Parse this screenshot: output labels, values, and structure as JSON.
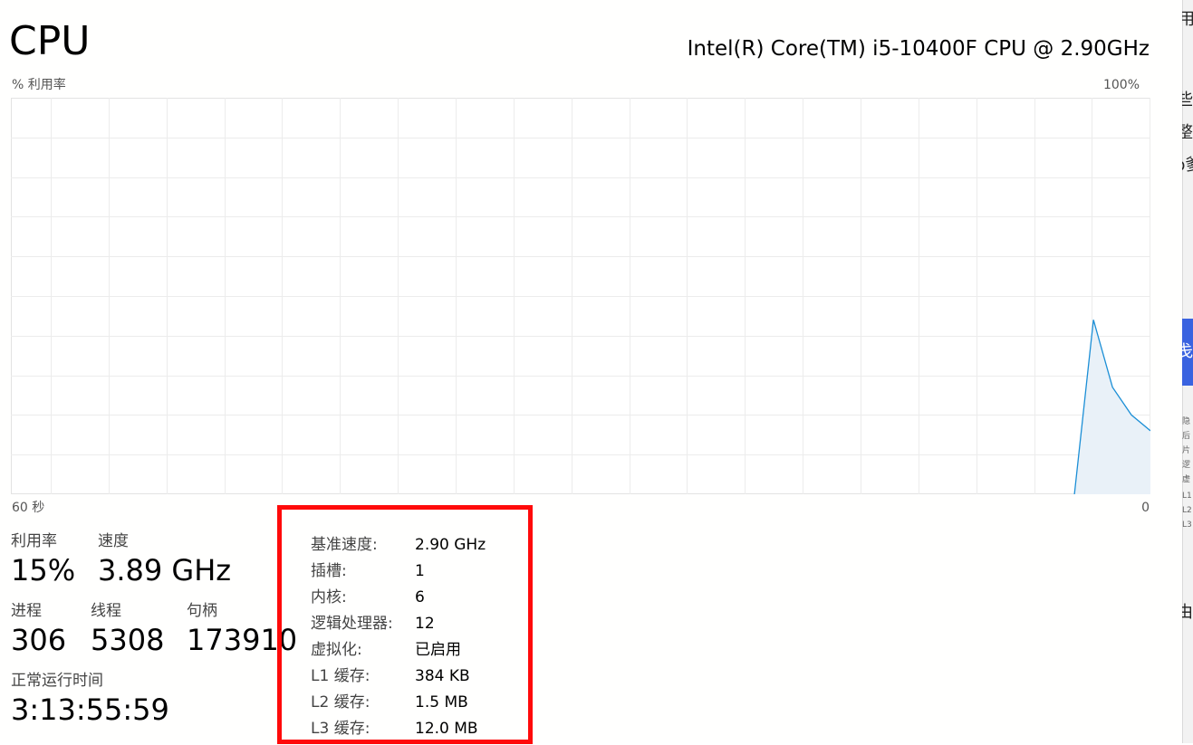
{
  "header": {
    "title": "CPU",
    "cpu_model": "Intel(R) Core(TM) i5-10400F CPU @ 2.90GHz"
  },
  "graph": {
    "y_label": "% 利用率",
    "y_max_label": "100%",
    "x_left_label": "60 秒",
    "x_right_label": "0",
    "utilization_percent_recent": [
      0,
      44,
      27,
      20,
      16
    ],
    "line_color": "#1c8fd6",
    "fill_color": "#e9f1f8",
    "grid_color": "#ececec"
  },
  "stats": {
    "utilization_label": "利用率",
    "utilization_value": "15%",
    "speed_label": "速度",
    "speed_value": "3.89 GHz",
    "processes_label": "进程",
    "processes_value": "306",
    "threads_label": "线程",
    "threads_value": "5308",
    "handles_label": "句柄",
    "handles_value": "173910",
    "uptime_label": "正常运行时间",
    "uptime_value": "3:13:55:59"
  },
  "info": {
    "highlight_color": "#ff0a0a",
    "rows": [
      {
        "key": "基准速度:",
        "value": "2.90 GHz"
      },
      {
        "key": "插槽:",
        "value": "1"
      },
      {
        "key": "内核:",
        "value": "6"
      },
      {
        "key": "逻辑处理器:",
        "value": "12"
      },
      {
        "key": "虚拟化:",
        "value": "已启用"
      },
      {
        "key": "L1 缓存:",
        "value": "384 KB"
      },
      {
        "key": "L2 缓存:",
        "value": "1.5 MB"
      },
      {
        "key": "L3 缓存:",
        "value": "12.0 MB"
      }
    ]
  },
  "side_panel": {
    "fragments": [
      "用",
      "些",
      "整",
      "b爹",
      "戋",
      "由"
    ],
    "tiny_fragments": [
      "隐",
      "后",
      "片",
      "逻",
      "虚",
      "L1",
      "L2",
      "L3"
    ],
    "accent_color": "#3a63e0"
  }
}
